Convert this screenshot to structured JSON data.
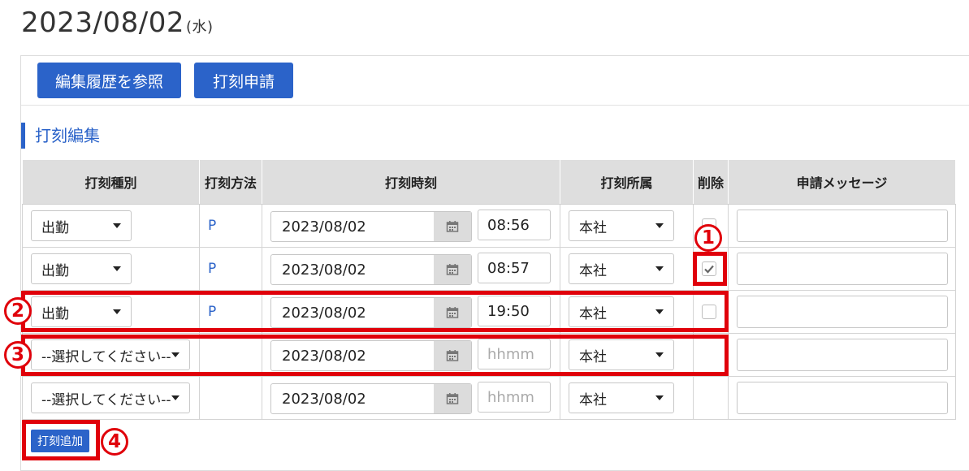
{
  "title": {
    "date": "2023/08/02",
    "dow": "(水)"
  },
  "toolbar": {
    "history_label": "編集履歴を参照",
    "apply_label": "打刻申請"
  },
  "section": {
    "title": "打刻編集"
  },
  "table": {
    "headers": [
      "打刻種別",
      "打刻方法",
      "打刻時刻",
      "打刻所属",
      "削除",
      "申請メッセージ"
    ],
    "rows": [
      {
        "type": "出勤",
        "method": "P",
        "date": "2023/08/02",
        "time": "08:56",
        "time_placeholder": "",
        "dept": "本社",
        "delete": false,
        "message": ""
      },
      {
        "type": "出勤",
        "method": "P",
        "date": "2023/08/02",
        "time": "08:57",
        "time_placeholder": "",
        "dept": "本社",
        "delete": true,
        "message": ""
      },
      {
        "type": "出勤",
        "method": "P",
        "date": "2023/08/02",
        "time": "19:50",
        "time_placeholder": "",
        "dept": "本社",
        "delete": false,
        "message": ""
      },
      {
        "type": "--選択してください--",
        "method": "",
        "date": "2023/08/02",
        "time": "",
        "time_placeholder": "hhmm",
        "dept": "本社",
        "delete": null,
        "message": ""
      },
      {
        "type": "--選択してください--",
        "method": "",
        "date": "2023/08/02",
        "time": "",
        "time_placeholder": "hhmm",
        "dept": "本社",
        "delete": null,
        "message": ""
      }
    ]
  },
  "add_button": {
    "label": "打刻追加"
  },
  "annotations": {
    "n1": "1",
    "n2": "2",
    "n3": "3",
    "n4": "4"
  },
  "colors": {
    "accent": "#2b63c9",
    "highlight": "#e0000a",
    "header_bg": "#dedede"
  },
  "icons": {
    "calendar": "calendar-icon",
    "dropdown": "chevron-down-icon",
    "check": "check-icon"
  }
}
